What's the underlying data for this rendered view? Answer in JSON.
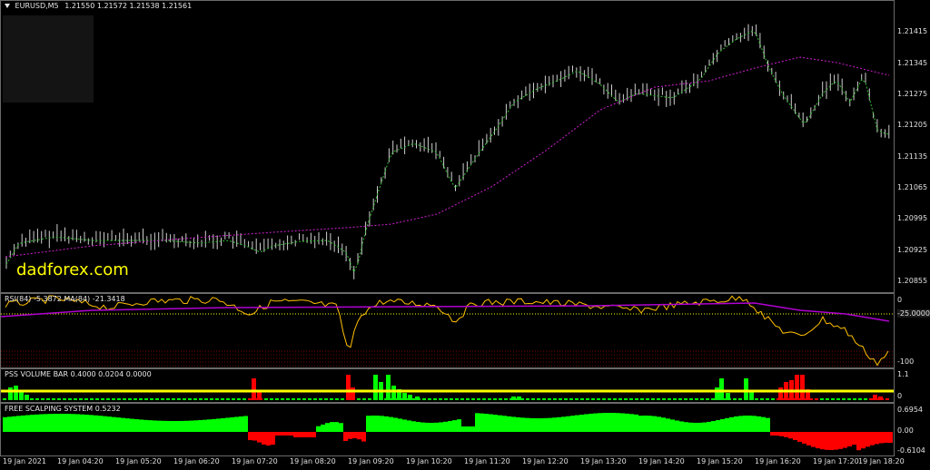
{
  "header": {
    "symbol": "EURUSD,M5",
    "ohlc": "1.21550 1.21572 1.21538 1.21561",
    "arrow_icon": "triangle-down-icon"
  },
  "watermark": "dadforex.com",
  "price_axis": [
    "1.21415",
    "1.21345",
    "1.21275",
    "1.21205",
    "1.21135",
    "1.21065",
    "1.20995",
    "1.20925",
    "1.20855"
  ],
  "rsi_pane": {
    "title": "RSI(84) -5.3872   MA(84) -21.3418",
    "axis": [
      "0",
      "-25.0000",
      "-100"
    ]
  },
  "volume_pane": {
    "title": "PSS VOLUME BAR 0.4000 0.0204 0.0000",
    "axis": [
      "1.1",
      "0"
    ]
  },
  "scalp_pane": {
    "title": "FREE SCALPING SYSTEM 0.5232",
    "axis": [
      "0.6954",
      "0.00",
      "-0.6104"
    ]
  },
  "time_axis": [
    "19 Jan 2021",
    "19 Jan 04:20",
    "19 Jan 05:20",
    "19 Jan 06:20",
    "19 Jan 07:20",
    "19 Jan 08:20",
    "19 Jan 09:20",
    "19 Jan 10:20",
    "19 Jan 11:20",
    "19 Jan 12:20",
    "19 Jan 13:20",
    "19 Jan 14:20",
    "19 Jan 15:20",
    "19 Jan 16:20",
    "19 Jan 17:20",
    "19 Jan 18:20"
  ],
  "colors": {
    "bars": "#cfcfcf",
    "fast_ma": "#2fbf2f",
    "slow_ma": "#d020d0",
    "rsi_line": "#ffc000",
    "rsi_ma": "#b000d0",
    "level": "#ffff00",
    "up": "#00ff00",
    "down": "#ff0000"
  }
}
